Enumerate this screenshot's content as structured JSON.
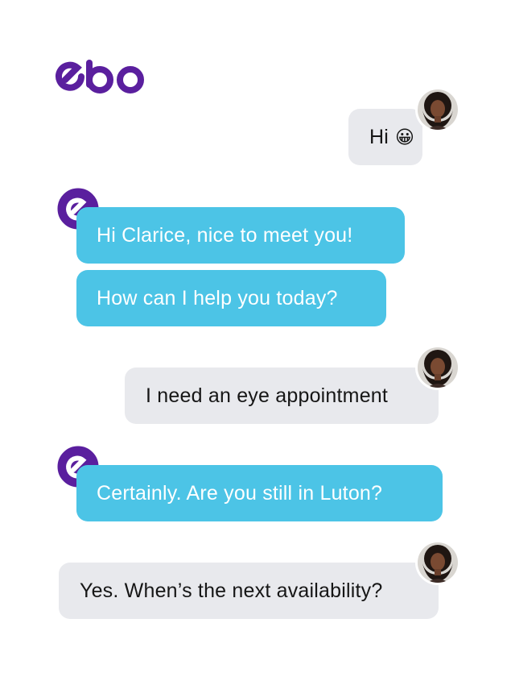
{
  "brand": {
    "logo_text": "ebo",
    "logo_color": "#5a1f9e"
  },
  "colors": {
    "bot_bubble": "#4cc4e6",
    "user_bubble": "#e8e9ed",
    "user_text": "#161616",
    "bot_text": "#ffffff"
  },
  "messages": [
    {
      "sender": "user",
      "text": "Hi",
      "emoji": "😀",
      "avatar_icon": "user-avatar-icon"
    },
    {
      "sender": "bot",
      "text": "Hi Clarice, nice to meet you!",
      "avatar_icon": "ebo-bot-icon"
    },
    {
      "sender": "bot",
      "text": "How can I help you today?"
    },
    {
      "sender": "user",
      "text": "I need an eye appointment",
      "avatar_icon": "user-avatar-icon"
    },
    {
      "sender": "bot",
      "text": "Certainly. Are you still in Luton?",
      "avatar_icon": "ebo-bot-icon"
    },
    {
      "sender": "user",
      "text": "Yes. When’s the next availability?",
      "avatar_icon": "user-avatar-icon"
    }
  ]
}
